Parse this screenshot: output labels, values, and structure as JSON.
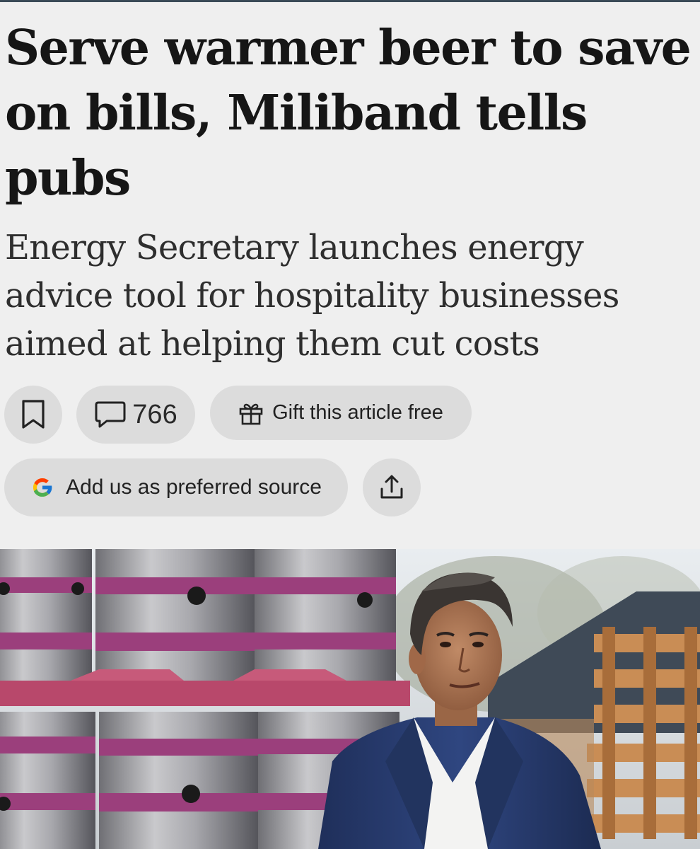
{
  "article": {
    "headline": "Serve warmer beer to save on bills, Miliband tells pubs",
    "standfirst": "Energy Secretary launches energy advice tool for hospitality businesses aimed at helping them cut costs"
  },
  "actions": {
    "bookmark_icon": "bookmark-icon",
    "comments_icon": "speech-bubble-icon",
    "comments_count": "766",
    "gift_icon": "gift-icon",
    "gift_label": "Gift this article free",
    "source_icon": "google-g-logo",
    "source_label": "Add us as preferred source",
    "share_icon": "share-upload-icon"
  },
  "photo": {
    "subject": "man in blue suit beside stacked beer kegs and wooden pallets"
  },
  "colors": {
    "background": "#efefef",
    "pill": "#dcdcdc",
    "text": "#161616",
    "keg_band": "#9b3f7c",
    "suit": "#273a6b"
  }
}
